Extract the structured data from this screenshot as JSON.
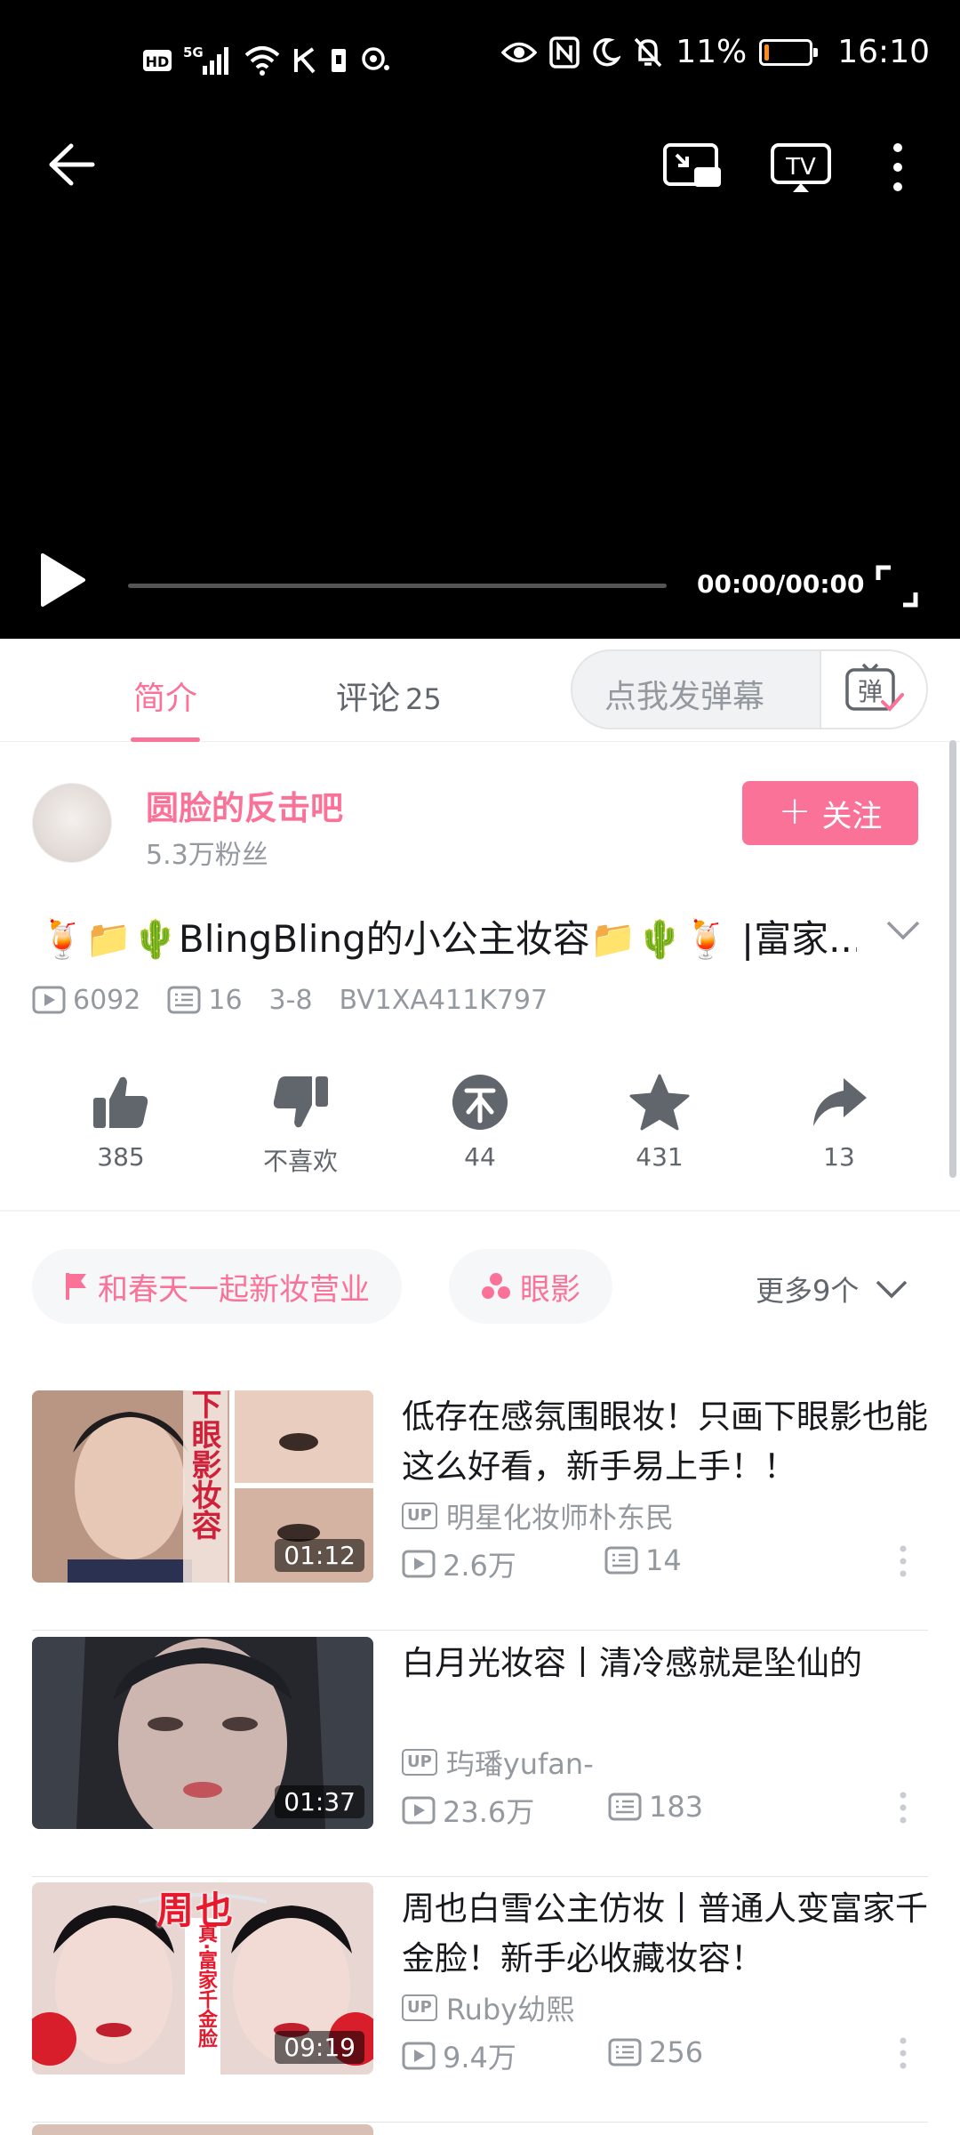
{
  "status_bar": {
    "left_icons": [
      "hd-icon",
      "5g-signal-icon",
      "wifi-icon",
      "k-icon",
      "sim-icon",
      "hotspot-icon"
    ],
    "right_icons": [
      "eye-icon",
      "nfc-icon",
      "moon-icon",
      "mute-bell-icon"
    ],
    "battery_text": "11%",
    "battery_level": 0.11,
    "time": "16:10"
  },
  "player": {
    "time_display": "00:00/00:00",
    "progress": 0
  },
  "tabs": {
    "intro": "简介",
    "comments": "评论",
    "comments_count": "25",
    "danmaku_placeholder": "点我发弹幕",
    "danmaku_icon_label": "弹"
  },
  "uploader": {
    "name": "圆脸的反击吧",
    "fans": "5.3万粉丝",
    "follow_label": "关注",
    "follow_icon": "+"
  },
  "video": {
    "title": "🍹📁🌵BlingBling的小公主妆容📁🌵🍹 |富家...",
    "views": "6092",
    "danmaku_count": "16",
    "date": "3-8",
    "bvid": "BV1XA411K797"
  },
  "actions": [
    {
      "icon": "thumbs-up-icon",
      "label": "385"
    },
    {
      "icon": "thumbs-down-icon",
      "label": "不喜欢"
    },
    {
      "icon": "coin-icon",
      "label": "44"
    },
    {
      "icon": "star-icon",
      "label": "431"
    },
    {
      "icon": "share-icon",
      "label": "13"
    }
  ],
  "tags": {
    "tag1": "和春天一起新妆营业",
    "tag2": "眼影",
    "more": "更多9个"
  },
  "colors": {
    "accent": "#fb7299",
    "text_primary": "#18191c",
    "text_secondary": "#9499a0",
    "battery_fill": "#ff8c1a"
  },
  "recommended": [
    {
      "title": "低存在感氛围眼妆！只画下眼影也能这么好看，新手易上手！！",
      "up_badge": "UP",
      "up": "明星化妆师朴东民",
      "views": "2.6万",
      "danmaku": "14",
      "duration": "01:12",
      "thumb_text": "下眼影妆容"
    },
    {
      "title": "白月光妆容丨清冷感就是坠仙的",
      "up_badge": "UP",
      "up": "玙璠yufan-",
      "views": "23.6万",
      "danmaku": "183",
      "duration": "01:37"
    },
    {
      "title": "周也白雪公主仿妆丨普通人变富家千金脸！新手必收藏妆容！",
      "up_badge": "UP",
      "up": "Ruby幼熙",
      "views": "9.4万",
      "danmaku": "256",
      "duration": "09:19",
      "thumb_title": "周也",
      "thumb_banner": "真·富家千金脸"
    }
  ]
}
